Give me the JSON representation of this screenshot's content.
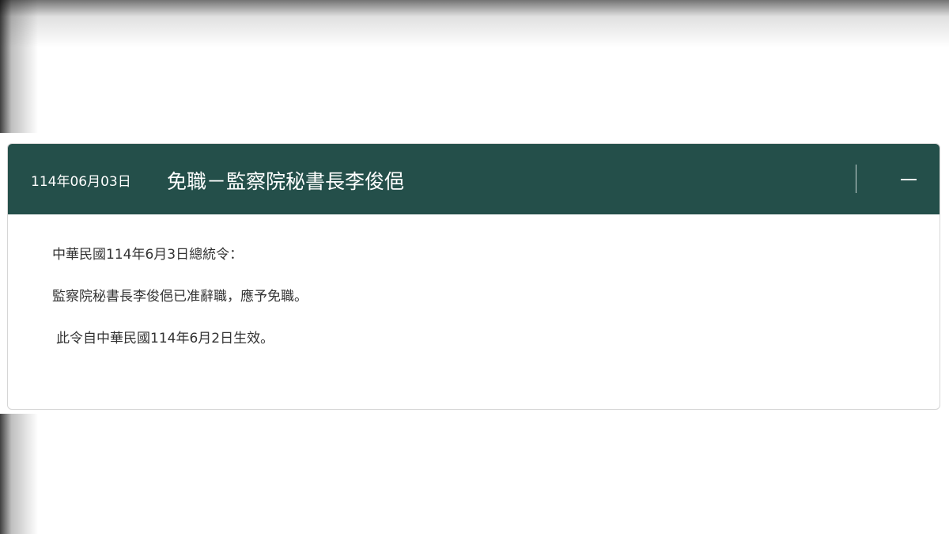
{
  "announcement": {
    "date": "114年06月03日",
    "title": "免職－監察院秘書長李俊俋",
    "collapse_icon": "minus-icon",
    "body": {
      "line1": "中華民國114年6月3日總統令：",
      "line2": "監察院秘書長李俊俋已准辭職，應予免職。",
      "line3": "此令自中華民國114年6月2日生效。"
    }
  },
  "colors": {
    "header_bg": "#244f4a",
    "header_text": "#ffffff",
    "body_text": "#333333",
    "border": "#d6d6d6"
  }
}
